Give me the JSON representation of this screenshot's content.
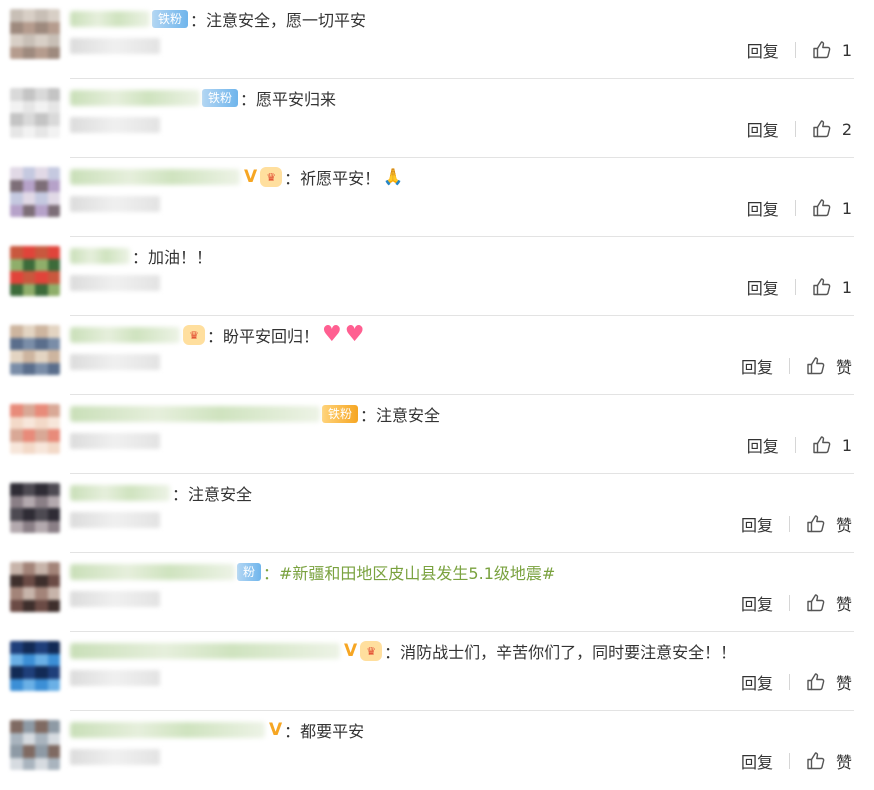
{
  "reply_label": "回复",
  "comments": [
    {
      "badge": "铁粉",
      "badge_style": "blue",
      "vip": false,
      "crown": false,
      "text": "：注意安全，愿一切平安",
      "emoji": "",
      "is_topic": false,
      "like_label": "1",
      "avatar_colors": [
        "#c8bfb6",
        "#b59c8e",
        "#d8cfc6",
        "#9e8a7e"
      ]
    },
    {
      "badge": "铁粉",
      "badge_style": "blue",
      "vip": false,
      "crown": false,
      "text": "：愿平安归来",
      "emoji": "",
      "is_topic": false,
      "like_label": "2",
      "avatar_colors": [
        "#f2f2f2",
        "#d9d9d9",
        "#e6e6e6",
        "#c4c4c4"
      ]
    },
    {
      "badge": "",
      "badge_style": "",
      "vip": true,
      "crown": true,
      "text": "：祈愿平安！",
      "emoji": "person",
      "is_topic": false,
      "like_label": "1",
      "avatar_colors": [
        "#c5c9e0",
        "#7d6e78",
        "#e1d9e6",
        "#b6a2c9"
      ]
    },
    {
      "badge": "",
      "badge_style": "",
      "vip": false,
      "crown": false,
      "text": "：加油！！",
      "emoji": "",
      "is_topic": false,
      "like_label": "1",
      "avatar_colors": [
        "#3c6b3a",
        "#e0443a",
        "#8fae6a",
        "#c9583e"
      ]
    },
    {
      "badge": "",
      "badge_style": "",
      "vip": false,
      "crown": true,
      "text": "：盼平安回归！",
      "emoji": "hearts",
      "is_topic": false,
      "like_label": "赞",
      "avatar_colors": [
        "#cdb59f",
        "#7a8da8",
        "#e3d4c2",
        "#5a6e8c"
      ]
    },
    {
      "badge": "铁粉",
      "badge_style": "gold",
      "vip": false,
      "crown": false,
      "text": "：注意安全",
      "emoji": "",
      "is_topic": false,
      "like_label": "1",
      "avatar_colors": [
        "#f3d9c8",
        "#e88b7a",
        "#f7e6da",
        "#d9a896"
      ]
    },
    {
      "badge": "",
      "badge_style": "",
      "vip": false,
      "crown": false,
      "text": "：注意安全",
      "emoji": "",
      "is_topic": false,
      "like_label": "赞",
      "avatar_colors": [
        "#4d4a52",
        "#8a7f86",
        "#2f2c35",
        "#b3a9ae"
      ]
    },
    {
      "badge": "粉",
      "badge_style": "blue",
      "vip": false,
      "crown": false,
      "text": "：#新疆和田地区皮山县发生5.1级地震#",
      "emoji": "",
      "is_topic": true,
      "like_label": "赞",
      "avatar_colors": [
        "#6b4b45",
        "#a38479",
        "#3e2f2c",
        "#c7b4aa"
      ]
    },
    {
      "badge": "",
      "badge_style": "",
      "vip": true,
      "crown": true,
      "text": "：消防战士们，辛苦你们了，同时要注意安全！！",
      "emoji": "",
      "is_topic": false,
      "like_label": "赞",
      "avatar_colors": [
        "#1f3f7a",
        "#3c8fd6",
        "#122a55",
        "#6ab0e6"
      ]
    },
    {
      "badge": "",
      "badge_style": "",
      "vip": true,
      "crown": false,
      "text": "：都要平安",
      "emoji": "",
      "is_topic": false,
      "like_label": "赞",
      "avatar_colors": [
        "#a9b4be",
        "#7f6a62",
        "#d6dbe0",
        "#8e9aa5"
      ]
    }
  ]
}
